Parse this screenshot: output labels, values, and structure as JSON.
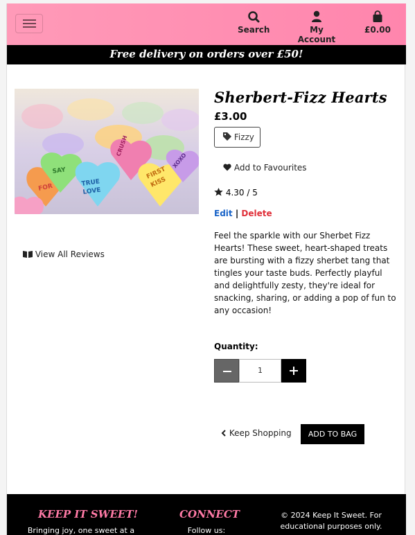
{
  "nav": {
    "search_label": "Search",
    "account_label": "My Account",
    "bag_total": "£0.00"
  },
  "banner": {
    "text": "Free delivery on orders over £50!"
  },
  "product": {
    "name": "Sherbert-Fizz Hearts",
    "price": "£3.00",
    "tag": "Fizzy",
    "favourite_label": "Add to Favourites",
    "rating": "4.30 / 5",
    "edit_label": "Edit",
    "separator": "|",
    "delete_label": "Delete",
    "description": "Feel the sparkle with our Sherbet Fizz Hearts! These sweet, heart-shaped treats are bursting with a fizzy sherbet tang that tingles your taste buds. Perfectly playful and delightfully zesty, they're ideal for snacking, sharing, or adding a pop of fun to any occasion!",
    "reviews_link": "View All Reviews",
    "image_alt_words": [
      "SAY YES",
      "TRUE LOVE",
      "FIRST KISS",
      "XOXO",
      "FOR EVER",
      "CRUSH"
    ]
  },
  "quantity": {
    "label": "Quantity:",
    "value": "1"
  },
  "actions": {
    "keep_shopping": "Keep Shopping",
    "add_to_bag": "ADD TO BAG"
  },
  "footer": {
    "brand_title": "KEEP IT SWEET!",
    "brand_text": "Bringing joy, one sweet at a",
    "connect_title": "CONNECT",
    "connect_text": "Follow us:",
    "copyright": "© 2024 Keep It Sweet. For educational purposes only."
  },
  "colors": {
    "header_pink": "#ff8fb2",
    "footer_title_pink": "#ff7aa6",
    "edit_blue": "#1a64c8",
    "delete_red": "#e0303a"
  }
}
